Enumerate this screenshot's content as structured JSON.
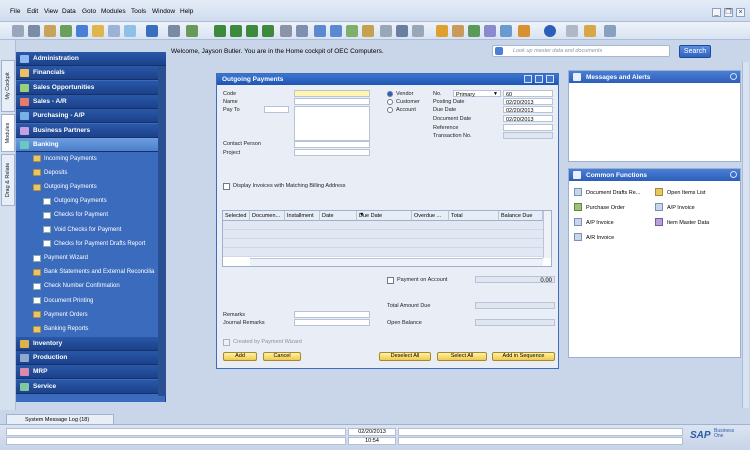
{
  "menubar": {
    "items": [
      "File",
      "Edit",
      "View",
      "Data",
      "Goto",
      "Modules",
      "Tools",
      "Window",
      "Help"
    ]
  },
  "side_tabs": [
    "My Cockpit",
    "Modules",
    "Drag & Relate"
  ],
  "left_menu": {
    "modules_top": [
      "Administration",
      "Financials",
      "Sales Opportunities",
      "Sales - A/R",
      "Purchasing - A/P",
      "Business Partners",
      "Banking"
    ],
    "banking_items": [
      {
        "label": "Incoming Payments",
        "level": 1,
        "icon": "folder"
      },
      {
        "label": "Deposits",
        "level": 1,
        "icon": "folder"
      },
      {
        "label": "Outgoing Payments",
        "level": 1,
        "icon": "folder-open"
      },
      {
        "label": "Outgoing Payments",
        "level": 2,
        "icon": "document"
      },
      {
        "label": "Checks for Payment",
        "level": 2,
        "icon": "document"
      },
      {
        "label": "Void Checks for Payment",
        "level": 2,
        "icon": "document"
      },
      {
        "label": "Checks for Payment Drafts Report",
        "level": 2,
        "icon": "document"
      },
      {
        "label": "Payment Wizard",
        "level": 1,
        "icon": "document"
      },
      {
        "label": "Bank Statements and External Reconcilia",
        "level": 1,
        "icon": "folder"
      },
      {
        "label": "Check Number Confirmation",
        "level": 1,
        "icon": "document"
      },
      {
        "label": "Document Printing",
        "level": 1,
        "icon": "document"
      },
      {
        "label": "Payment Orders",
        "level": 1,
        "icon": "folder"
      },
      {
        "label": "Banking Reports",
        "level": 1,
        "icon": "folder"
      }
    ],
    "modules_bottom": [
      "Inventory",
      "Production",
      "MRP",
      "Service"
    ]
  },
  "welcome": "Welcome, Jayson Butler. You are in the Home cockpit of OEC Computers.",
  "search": {
    "placeholder": "Look up master data and documents",
    "button": "Search"
  },
  "dialog": {
    "title": "Outgoing Payments",
    "left_labels": [
      "Code",
      "Name",
      "Pay To"
    ],
    "contact_label": "Contact Person",
    "project_label": "Project",
    "radio": [
      "Vendor",
      "Customer",
      "Account"
    ],
    "right_fields": [
      {
        "label": "No.",
        "series": "Primary",
        "value": "60"
      },
      {
        "label": "Posting Date",
        "value": "02/20/2013"
      },
      {
        "label": "Due Date",
        "value": "02/20/2013"
      },
      {
        "label": "Document Date",
        "value": "02/20/2013"
      },
      {
        "label": "Reference",
        "value": ""
      },
      {
        "label": "Transaction No.",
        "value": ""
      }
    ],
    "display_invoices": "Display Invoices with Matching Billing Address",
    "grid_columns": [
      "Selected",
      "Documen...",
      "Installment",
      "Date",
      "Due Date",
      "Overdue ...",
      "Total",
      "Balance Due"
    ],
    "payment_on_account": "Payment on Account",
    "payment_on_account_value": "0.00",
    "remarks": "Remarks",
    "journal_remarks": "Journal Remarks",
    "total_amount_due": "Total Amount Due",
    "open_balance": "Open Balance",
    "created_by_wizard": "Created by Payment Wizard",
    "buttons": {
      "add": "Add",
      "cancel": "Cancel",
      "deselect_all": "Deselect All",
      "select_all": "Select All",
      "add_in_sequence": "Add in Sequence"
    }
  },
  "panels": {
    "messages": "Messages and Alerts",
    "common": "Common Functions",
    "functions": [
      "Document Drafts Re...",
      "Open Items List",
      "Purchase Order",
      "A/P Invoice",
      "A/P Invoice",
      "Item Master Data",
      "A/R Invoice"
    ]
  },
  "bottom": {
    "msg_tab": "System Message Log (18)",
    "date": "02/20/2013",
    "time": "10:54",
    "brand": "SAP",
    "brand_sub": "Business One"
  },
  "colors": {
    "accent": "#2c5fb9",
    "button_yellow": "#f2c94c"
  }
}
